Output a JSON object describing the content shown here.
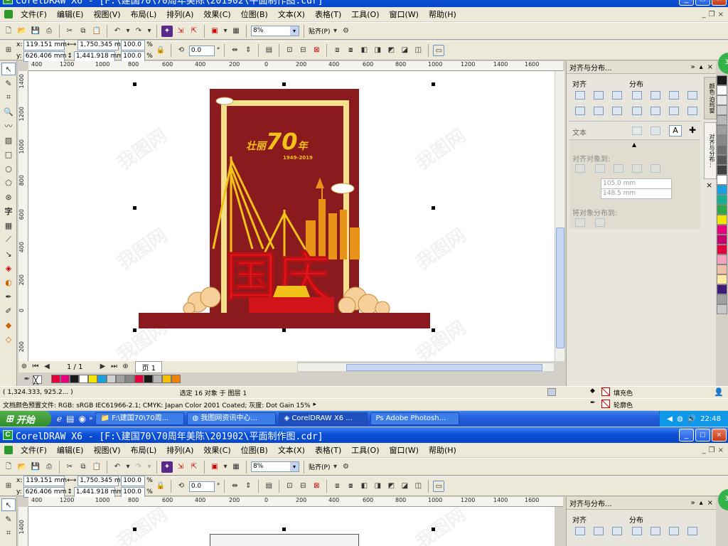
{
  "window_title": "CorelDRAW X6 - [F:\\建国70\\70周年美陈\\201902\\平面制作图.cdr]",
  "menu": [
    "文件(F)",
    "编辑(E)",
    "视图(V)",
    "布局(L)",
    "排列(A)",
    "效果(C)",
    "位图(B)",
    "文本(X)",
    "表格(T)",
    "工具(O)",
    "窗口(W)",
    "帮助(H)"
  ],
  "zoom": "8%",
  "snap_label": "贴齐(P)",
  "props": {
    "x": "119.151 mm",
    "y": "626.406 mm",
    "w": "1,750.345 mm",
    "h": "1,441.918 mm",
    "scale_x": "100.0",
    "scale_y": "100.0",
    "pct": "%",
    "angle": "0.0",
    "deg": "°"
  },
  "hruler": [
    "400",
    "1200",
    "1000",
    "800",
    "600",
    "400",
    "200",
    "0",
    "200",
    "400",
    "600",
    "800",
    "1000",
    "1200",
    "1400",
    "1600"
  ],
  "vruler": [
    "1400",
    "1200",
    "1000",
    "800",
    "600",
    "400",
    "200",
    "0",
    "200"
  ],
  "artwork": {
    "title_a": "壮丽",
    "title_num": "70",
    "title_b": "年",
    "years": "1949-2019",
    "big_text": "国庆"
  },
  "watermark": "我图网",
  "page_nav": {
    "current": "1 / 1",
    "tab": "页 1"
  },
  "palette_colors": [
    "#1a1a1a",
    "#ffffff",
    "#e8e8e8",
    "#d0d0d0",
    "#b8b8b8",
    "#a0a0a0",
    "#888888",
    "#707070",
    "#585858",
    "#404040",
    "#ffffff",
    "#1aa0e0",
    "#18b090",
    "#2aa84a",
    "#f2e600",
    "#e6007e",
    "#c80070",
    "#e4003a",
    "#f5a2c0",
    "#f0c0a8",
    "#ffeaa0",
    "#3c1a78",
    "#a0a0a0",
    "#c8c8c8"
  ],
  "bottom_palette": [
    "#e4003a",
    "#e6007e",
    "#1a1a1a",
    "#ffffff",
    "#f2e600",
    "#1aa0e0",
    "#d0d0d0",
    "#a0a0a0",
    "#888888",
    "#e4003a",
    "#1a1a1a",
    "#b8b8b8",
    "#f5c000",
    "#f08000"
  ],
  "docker": {
    "title": "对齐与分布...",
    "align": "对齐",
    "distribute": "分布",
    "text": "文本",
    "align_to": "对齐对象到:",
    "dim1": "105.0 mm",
    "dim2": "148.5 mm",
    "distribute_to": "将对象分布到:",
    "tab1": "颜色·泊坞窗",
    "tab2": "对齐与分布..."
  },
  "status": {
    "coords": "( 1,324.333, 925.2... )",
    "selection": "选定 16 对象 于 图层 1",
    "color_profile": "文档颜色预置文件: RGB: sRGB IEC61966-2.1; CMYK: Japan Color 2001 Coated; 灰度: Dot Gain 15%",
    "fill": "填充色",
    "outline": "轮廓色"
  },
  "taskbar": {
    "start": "开始",
    "tasks": [
      "F:\\建国70\\70周...",
      "我图网资讯中心...",
      "CorelDRAW X6 ...",
      "Adobe Photosh..."
    ],
    "time": "22:48"
  },
  "badge": "37"
}
